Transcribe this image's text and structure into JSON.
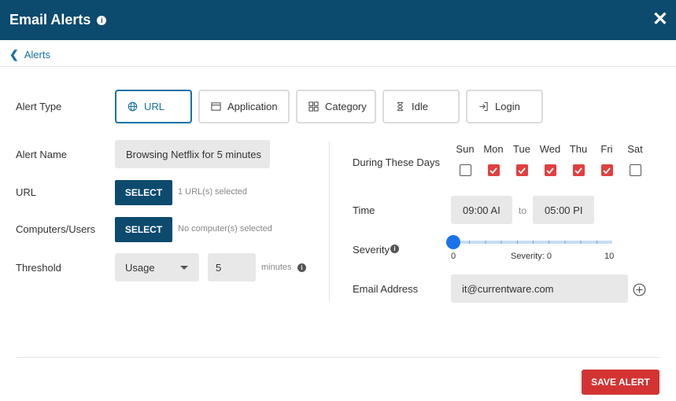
{
  "header": {
    "title": "Email Alerts",
    "info_glyph": "i",
    "close_glyph": "✕"
  },
  "breadcrumb": {
    "label": "Alerts"
  },
  "form": {
    "alert_type_label": "Alert Type",
    "alert_types": [
      {
        "label": "URL",
        "icon": "globe-icon",
        "active": true
      },
      {
        "label": "Application",
        "icon": "window-icon",
        "active": false
      },
      {
        "label": "Category",
        "icon": "grid-icon",
        "active": false
      },
      {
        "label": "Idle",
        "icon": "hourglass-icon",
        "active": false
      },
      {
        "label": "Login",
        "icon": "login-icon",
        "active": false
      }
    ],
    "alert_name_label": "Alert Name",
    "alert_name_value": "Browsing Netflix for 5 minutes",
    "url_label": "URL",
    "url_select": "SELECT",
    "url_hint": "1 URL(s) selected",
    "computers_label": "Computers/Users",
    "computers_select": "SELECT",
    "computers_hint": "No computer(s) selected",
    "threshold_label": "Threshold",
    "threshold_type": "Usage",
    "threshold_value": "5",
    "threshold_unit": "minutes",
    "days_label": "During These Days",
    "days": [
      {
        "label": "Sun",
        "checked": false
      },
      {
        "label": "Mon",
        "checked": true
      },
      {
        "label": "Tue",
        "checked": true
      },
      {
        "label": "Wed",
        "checked": true
      },
      {
        "label": "Thu",
        "checked": true
      },
      {
        "label": "Fri",
        "checked": true
      },
      {
        "label": "Sat",
        "checked": false
      }
    ],
    "time_label": "Time",
    "time_from": "09:00 AI",
    "time_to_sep": "to",
    "time_to": "05:00 PI",
    "severity_label": "Severity",
    "severity_min": "0",
    "severity_max": "10",
    "severity_value_text": "Severity: 0",
    "severity_value": 0,
    "email_label": "Email Address",
    "email_value": "it@currentware.com"
  },
  "footer": {
    "save_label": "SAVE ALERT"
  },
  "colors": {
    "header": "#0c4a6e",
    "accent": "#1671a6",
    "checked": "#e04040",
    "save": "#d33333",
    "slider": "#1a73e8"
  }
}
